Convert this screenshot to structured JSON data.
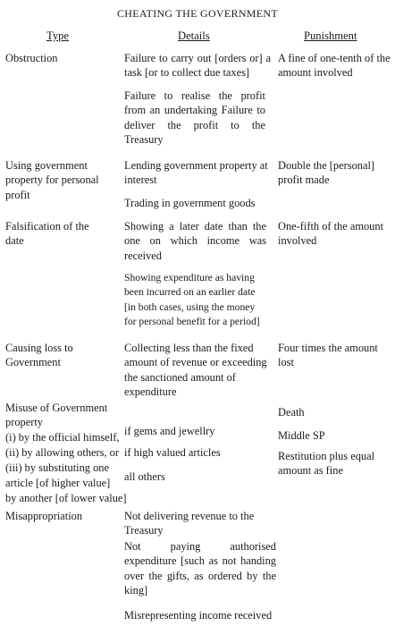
{
  "title": "CHEATING THE GOVERNMENT",
  "headers": {
    "type": "Type",
    "details": "Details",
    "punishment": "Punishment"
  },
  "rows": [
    {
      "type": "Obstruction",
      "details": [
        "Failure to carry out [orders or] a task [or to collect due taxes]",
        "Failure to realise the profit from an undertaking Failure to deliver the profit to the Treasury"
      ],
      "punishment": "A fine of one-tenth of the amount involved"
    },
    {
      "type": "Using government property for personal profit",
      "details": [
        "Lending government property at interest",
        "Trading in government goods"
      ],
      "punishment": "Double the [personal] profit made"
    },
    {
      "type": "Falsification of the date",
      "details": [
        "Showing a later date than the one on which income was received",
        "Showing expenditure as having been incurred on an earlier date [in both cases, using the money for personal benefit for a period]"
      ],
      "punishment": "One-fifth of the amount involved"
    },
    {
      "type": "Causing loss to Government",
      "details": [
        "Collecting less than the fixed amount of revenue or exceeding the sanctioned amount of expenditure"
      ],
      "punishment": "Four times the amount lost"
    },
    {
      "type_lines": [
        "Misuse of Government",
        "property",
        "(i) by the official himself,",
        "(ii) by allowing others, or",
        "(iii) by substituting one",
        "article [of higher value]",
        "by another [of lower value]"
      ],
      "details_items": [
        "if gems and jewellry",
        "if high valued articles",
        "all others"
      ],
      "punishment_items": [
        "Death",
        "Middle SP",
        "Restitution plus equal amount as fine"
      ]
    },
    {
      "type": "Misappropriation",
      "details": [
        "Not delivering revenue to the Treasury",
        "Not paying authorised expenditure [such as not handing over the gifts, as ordered by the king]",
        "Misrepresenting income received"
      ]
    }
  ]
}
